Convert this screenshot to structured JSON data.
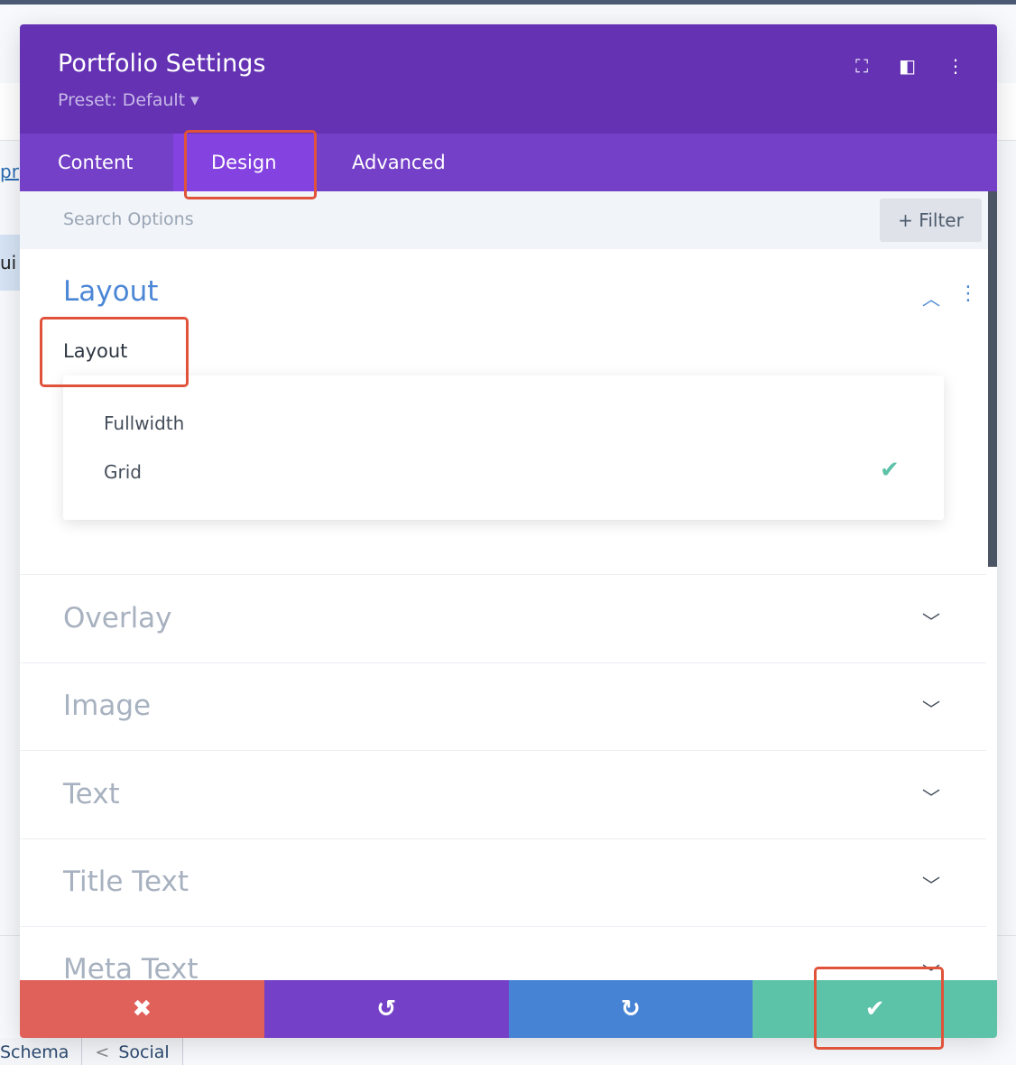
{
  "background": {
    "link_fragment": "pr",
    "chip_fragment": "ui",
    "bottom_tabs": [
      {
        "label": "Schema"
      },
      {
        "label": "Social",
        "icon": "share-icon"
      }
    ]
  },
  "modal": {
    "title": "Portfolio Settings",
    "preset": "Preset: Default ▾",
    "header_icons": [
      "focus-icon",
      "sidebar-layout-icon",
      "more-vertical-icon"
    ],
    "tabs": [
      {
        "label": "Content"
      },
      {
        "label": "Design",
        "active": true
      },
      {
        "label": "Advanced"
      }
    ],
    "search": {
      "placeholder": "Search Options",
      "filter_label": "+ Filter"
    },
    "sections": [
      {
        "title": "Layout",
        "open": true
      },
      {
        "title": "Overlay"
      },
      {
        "title": "Image"
      },
      {
        "title": "Text"
      },
      {
        "title": "Title Text"
      },
      {
        "title": "Meta Text"
      }
    ],
    "layout_field": {
      "label": "Layout",
      "options": [
        "Fullwidth",
        "Grid"
      ],
      "selected": "Grid"
    },
    "footer": [
      {
        "action": "discard",
        "icon": "close-icon",
        "color": "#e0605a"
      },
      {
        "action": "undo",
        "icon": "undo-icon",
        "color": "#7540c8"
      },
      {
        "action": "redo",
        "icon": "redo-icon",
        "color": "#4783d4"
      },
      {
        "action": "save",
        "icon": "check-icon",
        "color": "#5cc2a8"
      }
    ]
  },
  "colors": {
    "header": "#6432b3",
    "tabs": "#7540c8",
    "active_tab": "#8442e0",
    "accent_blue": "#4c87d6",
    "highlight": "#e0533a"
  }
}
